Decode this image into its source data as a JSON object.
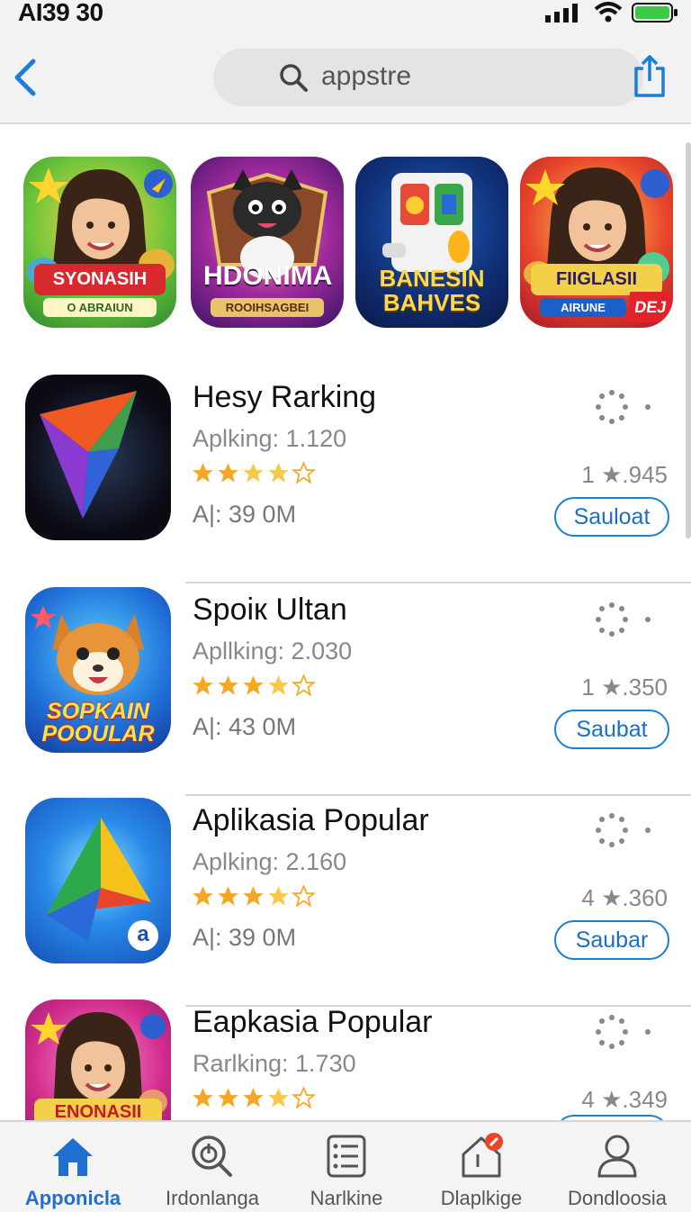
{
  "status": {
    "time": "AI39 30"
  },
  "search": {
    "query": "appstre"
  },
  "featured": [
    {
      "label": "SYONASIH",
      "sub": "O ABRAIUN"
    },
    {
      "label": "HDONIMA",
      "sub": "ROOIHSAGBEI"
    },
    {
      "label": "BANESIN BAHVES",
      "sub": ""
    },
    {
      "label": "FIIGLASII",
      "sub": "AIRUNE",
      "badge": "DEJ"
    }
  ],
  "apps": [
    {
      "name": "Hesy Rarking",
      "meta": "Aplking: 1.120",
      "size": "A|: 39 0M",
      "count": "1 ★.945",
      "button": "Sauloat",
      "rating": 4
    },
    {
      "name": "Spoiк Ultan",
      "meta": "Apllking: 2.030",
      "size": "A|: 43 0M",
      "count": "1 ★.350",
      "button": "Saubat",
      "rating": 4,
      "icon_text": "SOPKAIN POOULAR"
    },
    {
      "name": "Aplikasia Popular",
      "meta": "Aplking: 2.160",
      "size": "A|: 39 0M",
      "count": "4 ★.360",
      "button": "Saubar",
      "rating": 4,
      "icon_badge": "a"
    },
    {
      "name": "Eapkasia Popular",
      "meta": "Rarlking: 1.730",
      "size": "",
      "count": "4 ★.349",
      "button": "",
      "rating": 4,
      "icon_text": "ENONASII"
    }
  ],
  "tabs": [
    {
      "label": "Apponicla",
      "icon": "home-icon",
      "active": true
    },
    {
      "label": "Irdonlanga",
      "icon": "search-icon",
      "active": false
    },
    {
      "label": "Narlkine",
      "icon": "list-icon",
      "active": false
    },
    {
      "label": "Dlaplkige",
      "icon": "house-badge-icon",
      "active": false
    },
    {
      "label": "Dondloosia",
      "icon": "person-icon",
      "active": false
    }
  ],
  "colors": {
    "accent": "#1a7fd6",
    "star": "#f5a623"
  }
}
